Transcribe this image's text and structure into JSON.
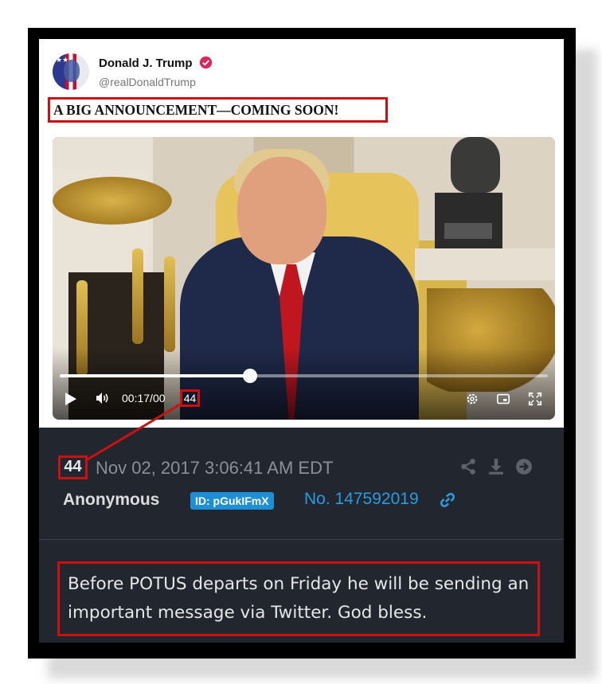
{
  "profile": {
    "name": "Donald J. Trump",
    "handle": "@realDonaldTrump"
  },
  "post": {
    "headline": "A BIG ANNOUNCEMENT—COMING SOON!"
  },
  "video": {
    "current_time": "00:17",
    "separator": "/",
    "duration_prefix": "00",
    "duration_highlight": "44",
    "progress_fraction": 0.39
  },
  "board_post": {
    "number_highlight": "44",
    "timestamp": "Nov 02, 2017 3:06:41 AM EDT",
    "author": "Anonymous",
    "id_badge": "ID: pGukIFmX",
    "post_number": "No. 147592019",
    "message": "Before POTUS departs on Friday he will be sending an important message via Twitter. God bless."
  },
  "colors": {
    "highlight_red": "#cc1010",
    "verified_pink": "#e0245e",
    "link_blue": "#2b9be0",
    "badge_blue": "#1c8fd6",
    "dark_bg": "#22262e"
  }
}
